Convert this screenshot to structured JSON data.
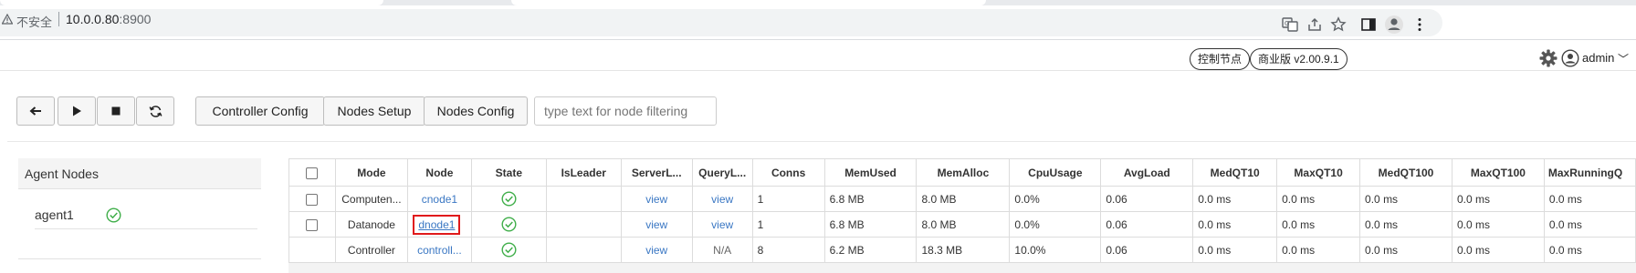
{
  "browser": {
    "insecure_label": "不安全",
    "url_host": "10.0.0.80",
    "url_port": ":8900"
  },
  "header": {
    "control_node_label": "控制节点",
    "edition_label": "商业版 v2.00.9.1",
    "user": "admin"
  },
  "toolbar": {
    "back_icon": "arrow-left-icon",
    "play_icon": "play-icon",
    "stop_icon": "stop-icon",
    "refresh_icon": "refresh-icon",
    "controller_config": "Controller Config",
    "nodes_setup": "Nodes Setup",
    "nodes_config": "Nodes Config",
    "filter_placeholder": "type text for node filtering"
  },
  "agent_panel": {
    "title": "Agent Nodes",
    "agents": [
      {
        "name": "agent1",
        "status": "ok"
      }
    ]
  },
  "grid": {
    "columns": [
      "",
      "Mode",
      "Node",
      "State",
      "IsLeader",
      "ServerL...",
      "QueryL...",
      "Conns",
      "MemUsed",
      "MemAlloc",
      "CpuUsage",
      "AvgLoad",
      "MedQT10",
      "MaxQT10",
      "MedQT100",
      "MaxQT100",
      "MaxRunningQ"
    ],
    "rows": [
      {
        "mode": "Computen...",
        "node": "cnode1",
        "state": "ok",
        "is_leader": "",
        "server_log": "view",
        "query_log": "view",
        "conns": "1",
        "mem_used": "6.8 MB",
        "mem_alloc": "8.0 MB",
        "cpu": "0.0%",
        "avg_load": "0.06",
        "med10": "0.0 ms",
        "max10": "0.0 ms",
        "med100": "0.0 ms",
        "max100": "0.0 ms",
        "maxrun": "0.0 ms"
      },
      {
        "mode": "Datanode",
        "node": "dnode1",
        "state": "ok",
        "is_leader": "",
        "server_log": "view",
        "query_log": "view",
        "conns": "1",
        "mem_used": "6.8 MB",
        "mem_alloc": "8.0 MB",
        "cpu": "0.0%",
        "avg_load": "0.06",
        "med10": "0.0 ms",
        "max10": "0.0 ms",
        "med100": "0.0 ms",
        "max100": "0.0 ms",
        "maxrun": "0.0 ms"
      },
      {
        "mode": "Controller",
        "node": "controll...",
        "state": "ok",
        "is_leader": "",
        "server_log": "view",
        "query_log": "N/A",
        "conns": "8",
        "mem_used": "6.2 MB",
        "mem_alloc": "18.3 MB",
        "cpu": "10.0%",
        "avg_load": "0.06",
        "med10": "0.0 ms",
        "max10": "0.0 ms",
        "med100": "0.0 ms",
        "max100": "0.0 ms",
        "maxrun": "0.0 ms"
      }
    ]
  },
  "colors": {
    "link": "#3a77c3",
    "ok_green": "#3fae49",
    "highlight": "#e0191b"
  }
}
